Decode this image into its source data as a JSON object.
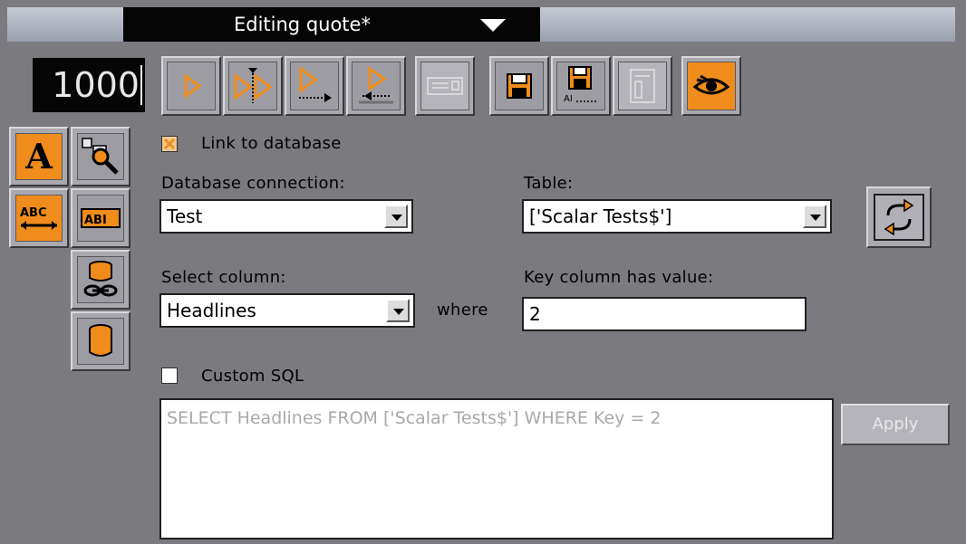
{
  "title": "Editing quote*",
  "counter": "1000",
  "toolbar": {
    "buttons": [
      {
        "name": "play-icon"
      },
      {
        "name": "step-play-icon"
      },
      {
        "name": "play-out-icon"
      },
      {
        "name": "play-in-icon"
      },
      {
        "name": "keyboard-icon"
      },
      {
        "name": "save-icon"
      },
      {
        "name": "save-as-icon"
      },
      {
        "name": "template-icon"
      },
      {
        "name": "preview-eye-icon"
      }
    ]
  },
  "side_tools": [
    {
      "name": "text-tool-icon",
      "glyph": "A"
    },
    {
      "name": "object-search-icon"
    },
    {
      "name": "text-width-icon",
      "glyph": "ABC"
    },
    {
      "name": "text-field-icon",
      "glyph": "ABI"
    },
    {
      "name": "database-link-icon"
    },
    {
      "name": "database-icon"
    }
  ],
  "form": {
    "link_to_database": "Link to database",
    "link_checked": true,
    "db_connection_label": "Database connection:",
    "db_connection_value": "Test",
    "table_label": "Table:",
    "table_value": "['Scalar Tests$']",
    "select_column_label": "Select column:",
    "select_column_value": "Headlines",
    "where_label": "where",
    "key_column_label": "Key column has value:",
    "key_column_value": "2",
    "custom_sql_label": "Custom SQL",
    "custom_sql_checked": false,
    "sql_text": "SELECT Headlines FROM ['Scalar Tests$'] WHERE Key = 2",
    "apply_label": "Apply"
  },
  "colors": {
    "accent": "#f08c1c",
    "background": "#7b7b7f"
  }
}
